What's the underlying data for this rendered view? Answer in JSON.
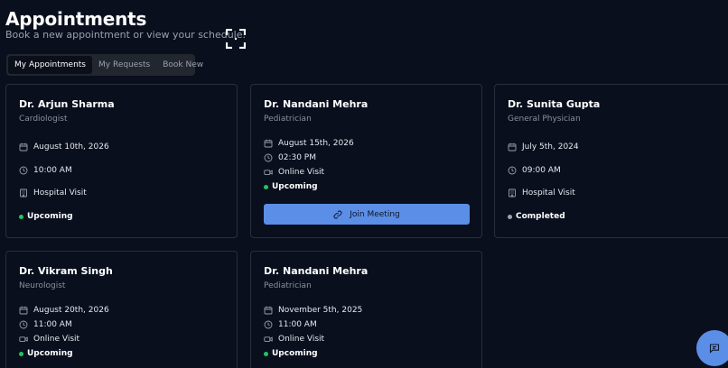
{
  "header": {
    "title": "Appointments",
    "subtitle": "Book a new appointment or view your schedule."
  },
  "tabs": [
    {
      "label": "My Appointments",
      "active": true
    },
    {
      "label": "My Requests",
      "active": false
    },
    {
      "label": "Book New",
      "active": false
    }
  ],
  "appointments": [
    {
      "doctor": "Dr. Arjun Sharma",
      "specialty": "Cardiologist",
      "date": "August 10th, 2026",
      "time": "10:00 AM",
      "visit_type": "Hospital Visit",
      "visit_icon": "building-icon",
      "status": "Upcoming",
      "status_color": "#22c55e"
    },
    {
      "doctor": "Dr. Nandani Mehra",
      "specialty": "Pediatrician",
      "date": "August 15th, 2026",
      "time": "02:30 PM",
      "visit_type": "Online Visit",
      "visit_icon": "video-icon",
      "status": "Upcoming",
      "status_color": "#22c55e",
      "action_label": "Join Meeting"
    },
    {
      "doctor": "Dr. Sunita Gupta",
      "specialty": "General Physician",
      "date": "July 5th, 2024",
      "time": "09:00 AM",
      "visit_type": "Hospital Visit",
      "visit_icon": "building-icon",
      "status": "Completed",
      "status_color": "#9ca3af"
    },
    {
      "doctor": "Dr. Vikram Singh",
      "specialty": "Neurologist",
      "date": "August 20th, 2026",
      "time": "11:00 AM",
      "visit_type": "Online Visit",
      "visit_icon": "video-icon",
      "status": "Upcoming",
      "status_color": "#22c55e"
    },
    {
      "doctor": "Dr. Nandani Mehra",
      "specialty": "Pediatrician",
      "date": "November 5th, 2025",
      "time": "11:00 AM",
      "visit_type": "Online Visit",
      "visit_icon": "video-icon",
      "status": "Upcoming",
      "status_color": "#22c55e"
    }
  ],
  "colors": {
    "background": "#0a0f1e",
    "accent": "#5b8ee6",
    "card_border": "#2a2e38"
  },
  "icons": {
    "focus": "focus-frame-icon",
    "date": "calendar-icon",
    "time": "clock-icon",
    "join": "link-icon",
    "chat": "chat-icon"
  }
}
